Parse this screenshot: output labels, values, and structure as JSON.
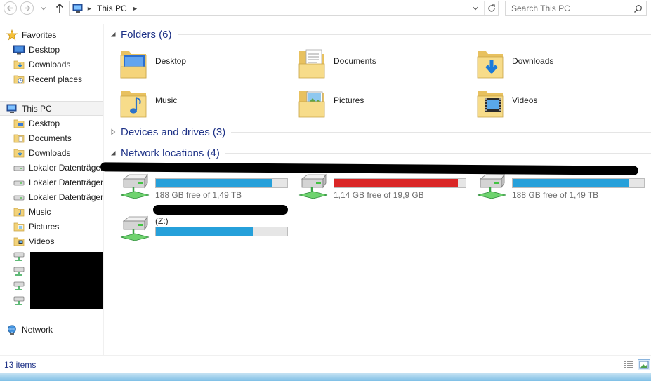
{
  "address": {
    "crumb": "This PC",
    "search_placeholder": "Search This PC"
  },
  "nav": {
    "favorites": {
      "label": "Favorites",
      "items": [
        "Desktop",
        "Downloads",
        "Recent places"
      ]
    },
    "this_pc": {
      "label": "This PC",
      "items": [
        "Desktop",
        "Documents",
        "Downloads",
        "Lokaler Datenträger",
        "Lokaler Datenträger",
        "Lokaler Datenträger",
        "Music",
        "Pictures",
        "Videos"
      ]
    },
    "network": {
      "label": "Network"
    }
  },
  "groups": {
    "folders": {
      "title": "Folders (6)"
    },
    "devices": {
      "title": "Devices and drives (3)"
    },
    "network": {
      "title": "Network locations (4)"
    }
  },
  "folders": [
    {
      "name": "Desktop",
      "icon": "folder-desktop-icon"
    },
    {
      "name": "Documents",
      "icon": "folder-documents-icon"
    },
    {
      "name": "Downloads",
      "icon": "folder-downloads-icon"
    },
    {
      "name": "Music",
      "icon": "folder-music-icon"
    },
    {
      "name": "Pictures",
      "icon": "folder-pictures-icon"
    },
    {
      "name": "Videos",
      "icon": "folder-videos-icon"
    }
  ],
  "network_locations": [
    {
      "label": "",
      "free_text": "188 GB free of 1,49 TB",
      "used_fraction": 0.88,
      "status": "normal"
    },
    {
      "label": "",
      "free_text": "1,14 GB free of 19,9 GB",
      "used_fraction": 0.94,
      "status": "low"
    },
    {
      "label": "",
      "free_text": "188 GB free of 1,49 TB",
      "used_fraction": 0.88,
      "status": "normal"
    },
    {
      "label": "(Z:)",
      "free_text": "",
      "used_fraction": 0.74,
      "status": "normal"
    }
  ],
  "status": {
    "item_count": "13 items"
  },
  "colors": {
    "bar_normal": "#26a0da",
    "bar_low": "#da2626",
    "group_title": "#1e3287"
  }
}
